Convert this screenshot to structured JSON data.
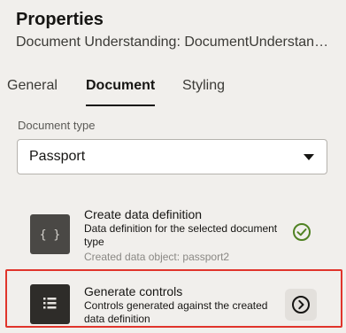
{
  "header": {
    "title": "Properties",
    "subtitle": "Document Understanding: DocumentUnderstanding"
  },
  "tabs": [
    {
      "label": "General",
      "active": false
    },
    {
      "label": "Document",
      "active": true
    },
    {
      "label": "Styling",
      "active": false
    }
  ],
  "document_type": {
    "label": "Document type",
    "value": "Passport"
  },
  "steps": [
    {
      "icon": "curly-braces-icon",
      "title": "Create data definition",
      "description": "Data definition for the selected document type",
      "meta": "Created data object: passport2",
      "status_icon": "check-circle-icon"
    },
    {
      "icon": "form-list-icon",
      "title": "Generate controls",
      "description": "Controls generated against the created data definition",
      "action_icon": "chevron-right-circle-icon"
    }
  ],
  "colors": {
    "background": "#f1efec",
    "success": "#508223",
    "highlight": "#e0342b"
  }
}
